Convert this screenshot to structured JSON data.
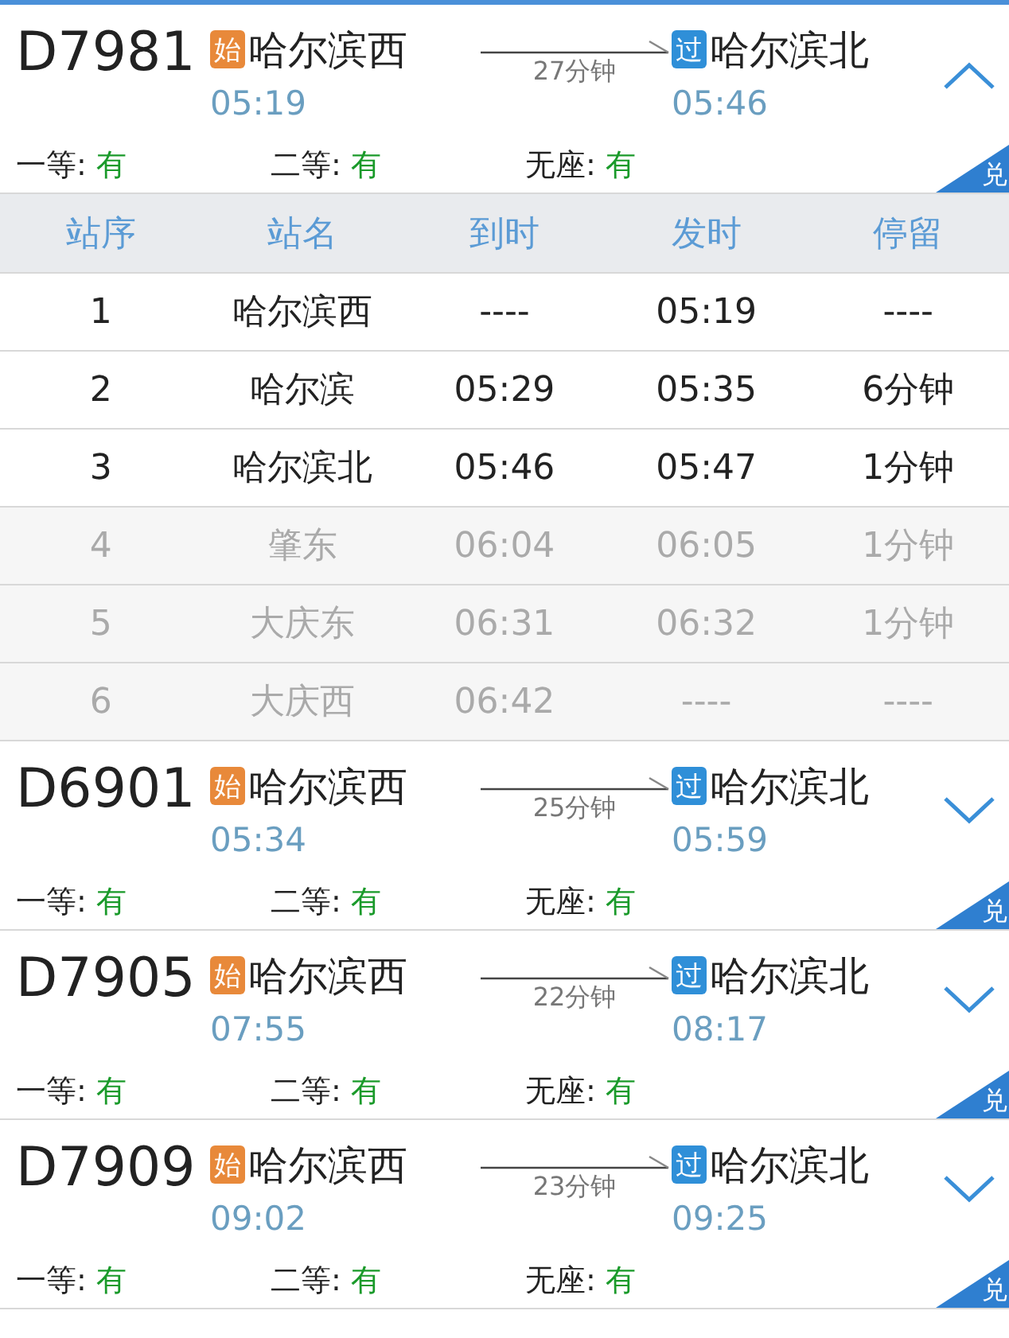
{
  "trains": [
    {
      "number": "D7981",
      "expanded": true,
      "from": {
        "kind": "start",
        "badge": "始",
        "name": "哈尔滨西",
        "time": "05:19"
      },
      "duration": "27分钟",
      "to": {
        "kind": "pass",
        "badge": "过",
        "name": "哈尔滨北",
        "time": "05:46"
      },
      "seats": [
        {
          "label": "一等:",
          "value": "有"
        },
        {
          "label": "二等:",
          "value": "有"
        },
        {
          "label": "无座:",
          "value": "有"
        }
      ],
      "corner": "兑",
      "stop_columns": [
        "站序",
        "站名",
        "到时",
        "发时",
        "停留"
      ],
      "stops": [
        {
          "in_range": true,
          "cells": [
            "1",
            "哈尔滨西",
            "----",
            "05:19",
            "----"
          ]
        },
        {
          "in_range": true,
          "cells": [
            "2",
            "哈尔滨",
            "05:29",
            "05:35",
            "6分钟"
          ]
        },
        {
          "in_range": true,
          "cells": [
            "3",
            "哈尔滨北",
            "05:46",
            "05:47",
            "1分钟"
          ]
        },
        {
          "in_range": false,
          "cells": [
            "4",
            "肇东",
            "06:04",
            "06:05",
            "1分钟"
          ]
        },
        {
          "in_range": false,
          "cells": [
            "5",
            "大庆东",
            "06:31",
            "06:32",
            "1分钟"
          ]
        },
        {
          "in_range": false,
          "cells": [
            "6",
            "大庆西",
            "06:42",
            "----",
            "----"
          ]
        }
      ]
    },
    {
      "number": "D6901",
      "expanded": false,
      "from": {
        "kind": "start",
        "badge": "始",
        "name": "哈尔滨西",
        "time": "05:34"
      },
      "duration": "25分钟",
      "to": {
        "kind": "pass",
        "badge": "过",
        "name": "哈尔滨北",
        "time": "05:59"
      },
      "seats": [
        {
          "label": "一等:",
          "value": "有"
        },
        {
          "label": "二等:",
          "value": "有"
        },
        {
          "label": "无座:",
          "value": "有"
        }
      ],
      "corner": "兑"
    },
    {
      "number": "D7905",
      "expanded": false,
      "from": {
        "kind": "start",
        "badge": "始",
        "name": "哈尔滨西",
        "time": "07:55"
      },
      "duration": "22分钟",
      "to": {
        "kind": "pass",
        "badge": "过",
        "name": "哈尔滨北",
        "time": "08:17"
      },
      "seats": [
        {
          "label": "一等:",
          "value": "有"
        },
        {
          "label": "二等:",
          "value": "有"
        },
        {
          "label": "无座:",
          "value": "有"
        }
      ],
      "corner": "兑"
    },
    {
      "number": "D7909",
      "expanded": false,
      "from": {
        "kind": "start",
        "badge": "始",
        "name": "哈尔滨西",
        "time": "09:02"
      },
      "duration": "23分钟",
      "to": {
        "kind": "pass",
        "badge": "过",
        "name": "哈尔滨北",
        "time": "09:25"
      },
      "seats": [
        {
          "label": "一等:",
          "value": "有"
        },
        {
          "label": "二等:",
          "value": "有"
        },
        {
          "label": "无座:",
          "value": "有"
        }
      ],
      "corner": "兑"
    }
  ]
}
